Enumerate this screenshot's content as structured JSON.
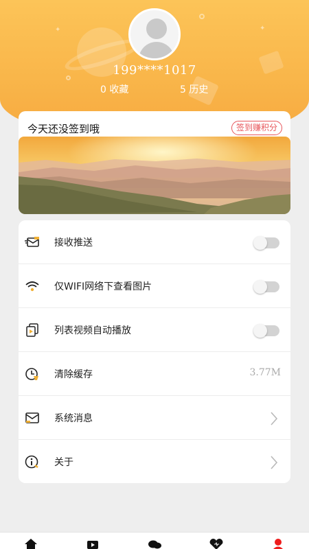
{
  "profile": {
    "username": "199****1017",
    "favorites": "0 收藏",
    "history": "5 历史"
  },
  "checkin": {
    "text": "今天还没签到哦",
    "button": "签到赚积分"
  },
  "settings": {
    "push": {
      "label": "接收推送",
      "enabled": false
    },
    "wifi_images": {
      "label": "仅WIFI网络下查看图片",
      "enabled": false
    },
    "autoplay": {
      "label": "列表视频自动播放",
      "enabled": false
    },
    "clear_cache": {
      "label": "清除缓存",
      "value": "3.77M"
    },
    "messages": {
      "label": "系统消息"
    },
    "about": {
      "label": "关于"
    }
  },
  "tabbar": {
    "items": [
      {
        "icon": "home-icon"
      },
      {
        "icon": "video-icon"
      },
      {
        "icon": "chat-icon"
      },
      {
        "icon": "heart-icon"
      },
      {
        "icon": "profile-icon",
        "active": true
      }
    ]
  },
  "colors": {
    "accent": "#e7555a",
    "header_top": "#fcc458",
    "header_bottom": "#f6a83f",
    "active_tab": "#ee1c1c"
  }
}
